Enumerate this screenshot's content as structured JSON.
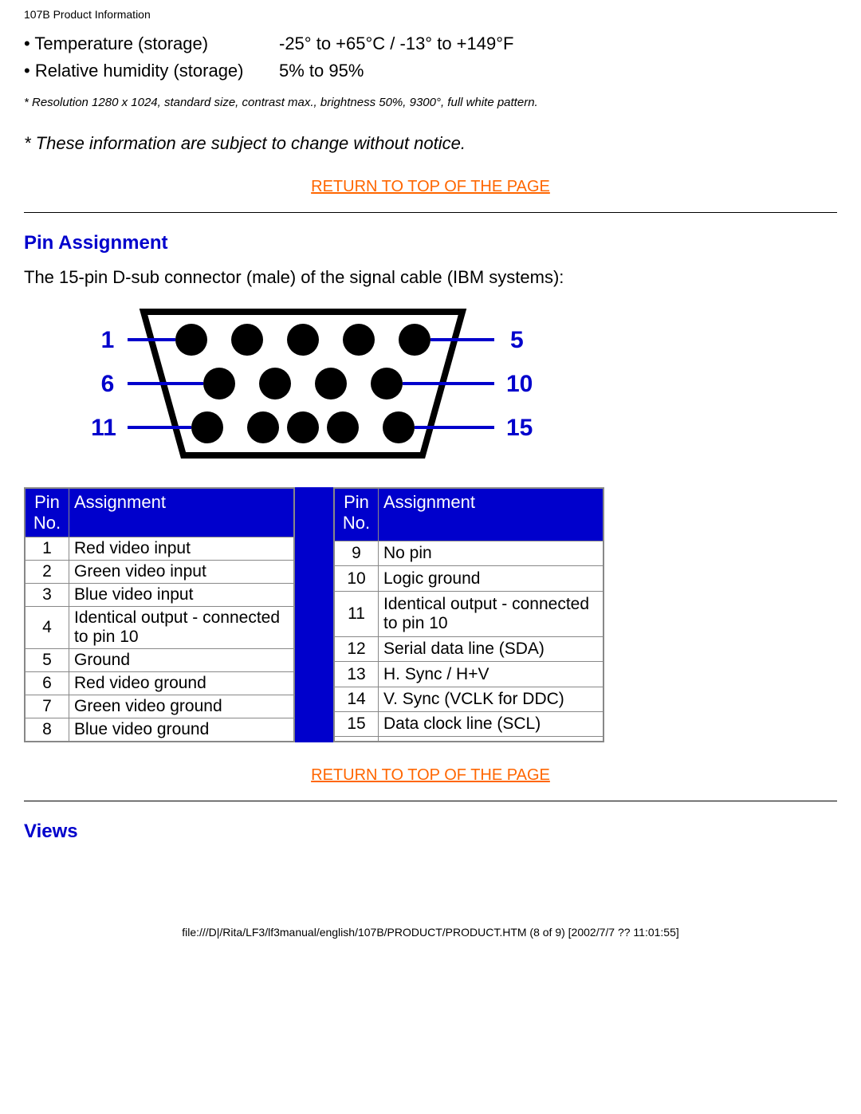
{
  "header": "107B Product Information",
  "specs": [
    {
      "label": "Temperature (storage)",
      "value": "-25° to +65°C / -13° to +149°F"
    },
    {
      "label": "Relative humidity (storage)",
      "value": "5% to 95%"
    }
  ],
  "footnote": "* Resolution 1280 x 1024, standard size, contrast max., brightness 50%, 9300°, full white pattern.",
  "notice": "* These information are subject to change without notice.",
  "return_link": "RETURN TO TOP OF THE PAGE",
  "pin_section": {
    "heading": "Pin Assignment",
    "intro": "The 15-pin D-sub connector (male) of the signal cable (IBM systems):"
  },
  "pin_header_no": "Pin No.",
  "pin_header_assign": "Assignment",
  "pins_left": [
    {
      "no": "1",
      "assign": "Red video input"
    },
    {
      "no": "2",
      "assign": "Green video input"
    },
    {
      "no": "3",
      "assign": "Blue video input"
    },
    {
      "no": "4",
      "assign": "Identical output - connected to pin 10"
    },
    {
      "no": "5",
      "assign": "Ground"
    },
    {
      "no": "6",
      "assign": "Red video ground"
    },
    {
      "no": "7",
      "assign": "Green video ground"
    },
    {
      "no": "8",
      "assign": "Blue video ground"
    }
  ],
  "pins_right": [
    {
      "no": "9",
      "assign": "No pin"
    },
    {
      "no": "10",
      "assign": "Logic ground"
    },
    {
      "no": "11",
      "assign": "Identical output - connected to pin 10"
    },
    {
      "no": "12",
      "assign": "Serial data line (SDA)"
    },
    {
      "no": "13",
      "assign": "H. Sync / H+V"
    },
    {
      "no": "14",
      "assign": "V. Sync (VCLK for DDC)"
    },
    {
      "no": "15",
      "assign": "Data clock line (SCL)"
    },
    {
      "no": "",
      "assign": ""
    }
  ],
  "conn_labels": {
    "l1": "1",
    "l6": "6",
    "l11": "11",
    "r5": "5",
    "r10": "10",
    "r15": "15"
  },
  "views_heading": "Views",
  "footer_path": "file:///D|/Rita/LF3/lf3manual/english/107B/PRODUCT/PRODUCT.HTM (8 of 9) [2002/7/7 ?? 11:01:55]"
}
